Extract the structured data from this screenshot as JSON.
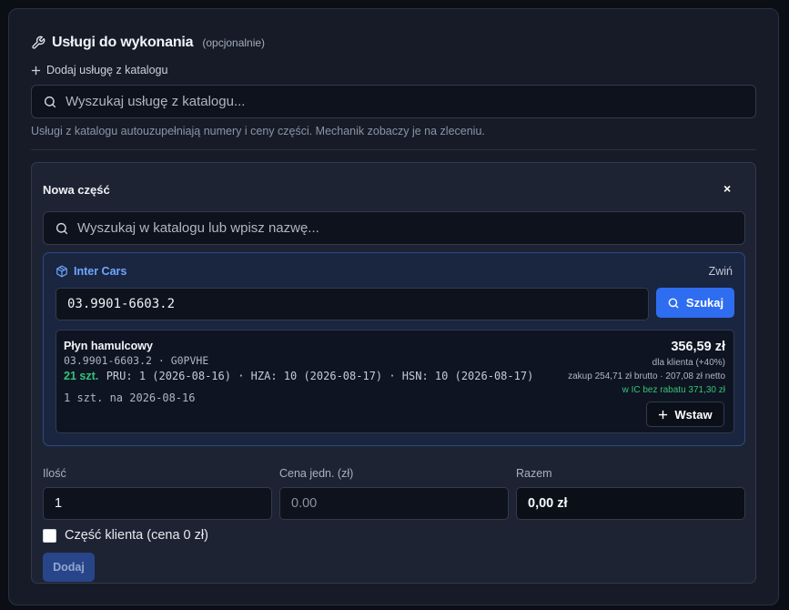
{
  "section": {
    "title": "Usługi do wykonania",
    "optional_label": "(opcjonalnie)",
    "add_from_catalog": "Dodaj usługę z katalogu",
    "catalog_search_placeholder": "Wyszukaj usługę z katalogu...",
    "hint": "Usługi z katalogu autouzupełniają numery i ceny części. Mechanik zobaczy je na zleceniu."
  },
  "new_part": {
    "title": "Nowa część",
    "close_label": "×",
    "search_placeholder": "Wyszukaj w katalogu lub wpisz nazwę...",
    "supplier": {
      "name": "Inter Cars",
      "collapse_label": "Zwiń",
      "code_value": "03.9901-6603.2",
      "search_button": "Szukaj",
      "result": {
        "name": "Płyn hamulcowy",
        "code_line": "03.9901-6603.2 · G0PVHE",
        "stock_qty": "21 szt.",
        "availability": "PRU: 1 (2026-08-16) · HZA: 10 (2026-08-17) · HSN: 10 (2026-08-17)",
        "delivery": "1 szt. na 2026-08-16",
        "price": "356,59 zł",
        "client_note": "dla klienta (+40%)",
        "purchase_note": "zakup 254,71 zł brutto · 207,08 zł netto",
        "ic_note": "w IC bez rabatu 371,30 zł",
        "insert_button": "Wstaw"
      }
    },
    "fields": {
      "quantity_label": "Ilość",
      "quantity_value": "1",
      "unit_price_label": "Cena jedn. (zł)",
      "unit_price_placeholder": "0.00",
      "total_label": "Razem",
      "total_value": "0,00 zł"
    },
    "client_part_label": "Część klienta (cena 0 zł)",
    "client_part_checked": false,
    "add_button": "Dodaj"
  },
  "colors": {
    "accent": "#2f6df0",
    "success": "#36c27a",
    "supplier": "#6ea8ff"
  }
}
